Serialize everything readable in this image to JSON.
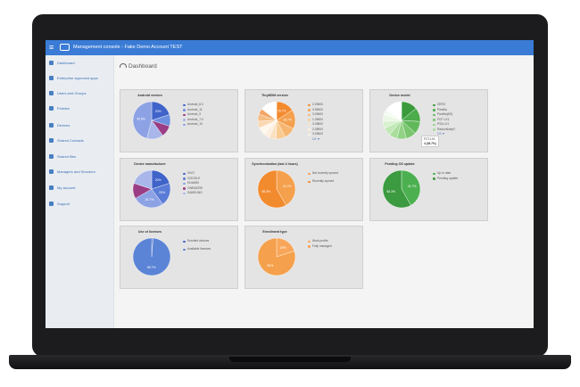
{
  "topbar": {
    "menu_icon": "hamburger-icon",
    "logo_icon": "device-icon",
    "title": "Management console - Fake Demo Account TEST"
  },
  "sidebar": {
    "items": [
      {
        "label": "Dashboard",
        "icon": "dashboard-icon"
      },
      {
        "label": "Enterprise approved apps",
        "icon": "apps-icon"
      },
      {
        "label": "Users and Groups",
        "icon": "users-icon"
      },
      {
        "label": "Policies",
        "icon": "policies-icon"
      },
      {
        "label": "Devices",
        "icon": "devices-icon"
      },
      {
        "label": "Shared Contacts",
        "icon": "contacts-icon"
      },
      {
        "label": "Shared files",
        "icon": "files-icon"
      },
      {
        "label": "Managers and Structure",
        "icon": "managers-icon"
      },
      {
        "label": "My account",
        "icon": "account-icon"
      },
      {
        "label": "Support",
        "icon": "support-icon"
      }
    ]
  },
  "page": {
    "title": "Dashboard",
    "title_icon": "gauge-icon"
  },
  "cards": [
    {
      "title": "Android version",
      "slices": [
        20,
        10,
        10,
        14.2,
        45.8
      ],
      "labels": [
        "20%",
        "",
        "",
        "",
        "45.8%"
      ],
      "colors": [
        "#3f63c9",
        "#6d8fe0",
        "#9a3d84",
        "#a8b6ea",
        "#8da2e4"
      ],
      "legend": [
        "Android_8.0",
        "Android_11",
        "Android_9",
        "Android_7.0",
        "Android_10"
      ]
    },
    {
      "title": "TinyMDM version",
      "slices": [
        15.7,
        16.7,
        10,
        8,
        6,
        5,
        7,
        6,
        6,
        5,
        14.6
      ],
      "labels": [
        "15.7%",
        "16.7%",
        "",
        "",
        "",
        "",
        "",
        "",
        "",
        "",
        ""
      ],
      "colors": [
        "#f28a2e",
        "#f4a04f",
        "#f6b670",
        "#f8cb92",
        "#fbe0c1",
        "#fdeede",
        "#fff6ec",
        "#f9d7b1",
        "#f5bd84",
        "#f3a664",
        "#ffffff"
      ],
      "legend": [
        "2.09600",
        "3.08400",
        "3.09600",
        "1.09600",
        "3.09800",
        "2.08900",
        "3.09600"
      ],
      "pager": "1/2"
    },
    {
      "title": "Device model",
      "slices": [
        14,
        12,
        11,
        9,
        8,
        7,
        7,
        6,
        6,
        5,
        15
      ],
      "labels": [
        "",
        "",
        "",
        "",
        "",
        "",
        "",
        "",
        "",
        "",
        ""
      ],
      "colors": [
        "#3a9a3c",
        "#4cab4b",
        "#62b95c",
        "#7ac66f",
        "#92d285",
        "#a9dd9c",
        "#c1e8b6",
        "#d8f1cf",
        "#e9f7e4",
        "#f5fbf3",
        "#ffffff"
      ],
      "legend": [
        "ZERO",
        "Pixel6a",
        "Pixel6a(5G)",
        "FCP-LX1",
        "PS4-LX1",
        "RadonNotep7"
      ],
      "pager": "1/2",
      "tooltip": {
        "line1": "FCT-LX1",
        "line2": "4 (26.7%)"
      }
    },
    {
      "title": "Device manufacturer",
      "slices": [
        20,
        20,
        26.7,
        13.3,
        20
      ],
      "labels": [
        "20%",
        "20%",
        "26.7%",
        "",
        ""
      ],
      "colors": [
        "#3f63c9",
        "#5b7cd6",
        "#8da2e4",
        "#9a3d84",
        "#a8b6ea"
      ],
      "legend": [
        "VIVO",
        "GOOGLE",
        "HUAWEI",
        "ONEMORE",
        "SAMSUNG"
      ]
    },
    {
      "title": "Synchronization (last 4 hours)",
      "slices": [
        41.7,
        58.3
      ],
      "labels": [
        "41.7%",
        "58.3%"
      ],
      "colors": [
        "#f5a04c",
        "#f28a2e"
      ],
      "legend": [
        "Not recently synced",
        "Recently synced"
      ]
    },
    {
      "title": "Pending OS update",
      "slices": [
        41.7,
        58.3
      ],
      "labels": [
        "41.7%",
        "58.3%"
      ],
      "colors": [
        "#4cb050",
        "#3c9a40"
      ],
      "legend": [
        "Up to date",
        "Pending update"
      ]
    },
    {
      "title": "Use of licenses",
      "slices": [
        1.2,
        98.8
      ],
      "labels": [
        "",
        "98.7%"
      ],
      "colors": [
        "#3f63c9",
        "#5b84d6"
      ],
      "legend": [
        "Enrolled devices",
        "Available licenses"
      ]
    },
    {
      "title": "Enrollment type",
      "slices": [
        20,
        80
      ],
      "labels": [
        "20%",
        "80%"
      ],
      "colors": [
        "#f8a75a",
        "#f5a04c"
      ],
      "legend": [
        "Work profile",
        "Fully managed"
      ]
    }
  ]
}
